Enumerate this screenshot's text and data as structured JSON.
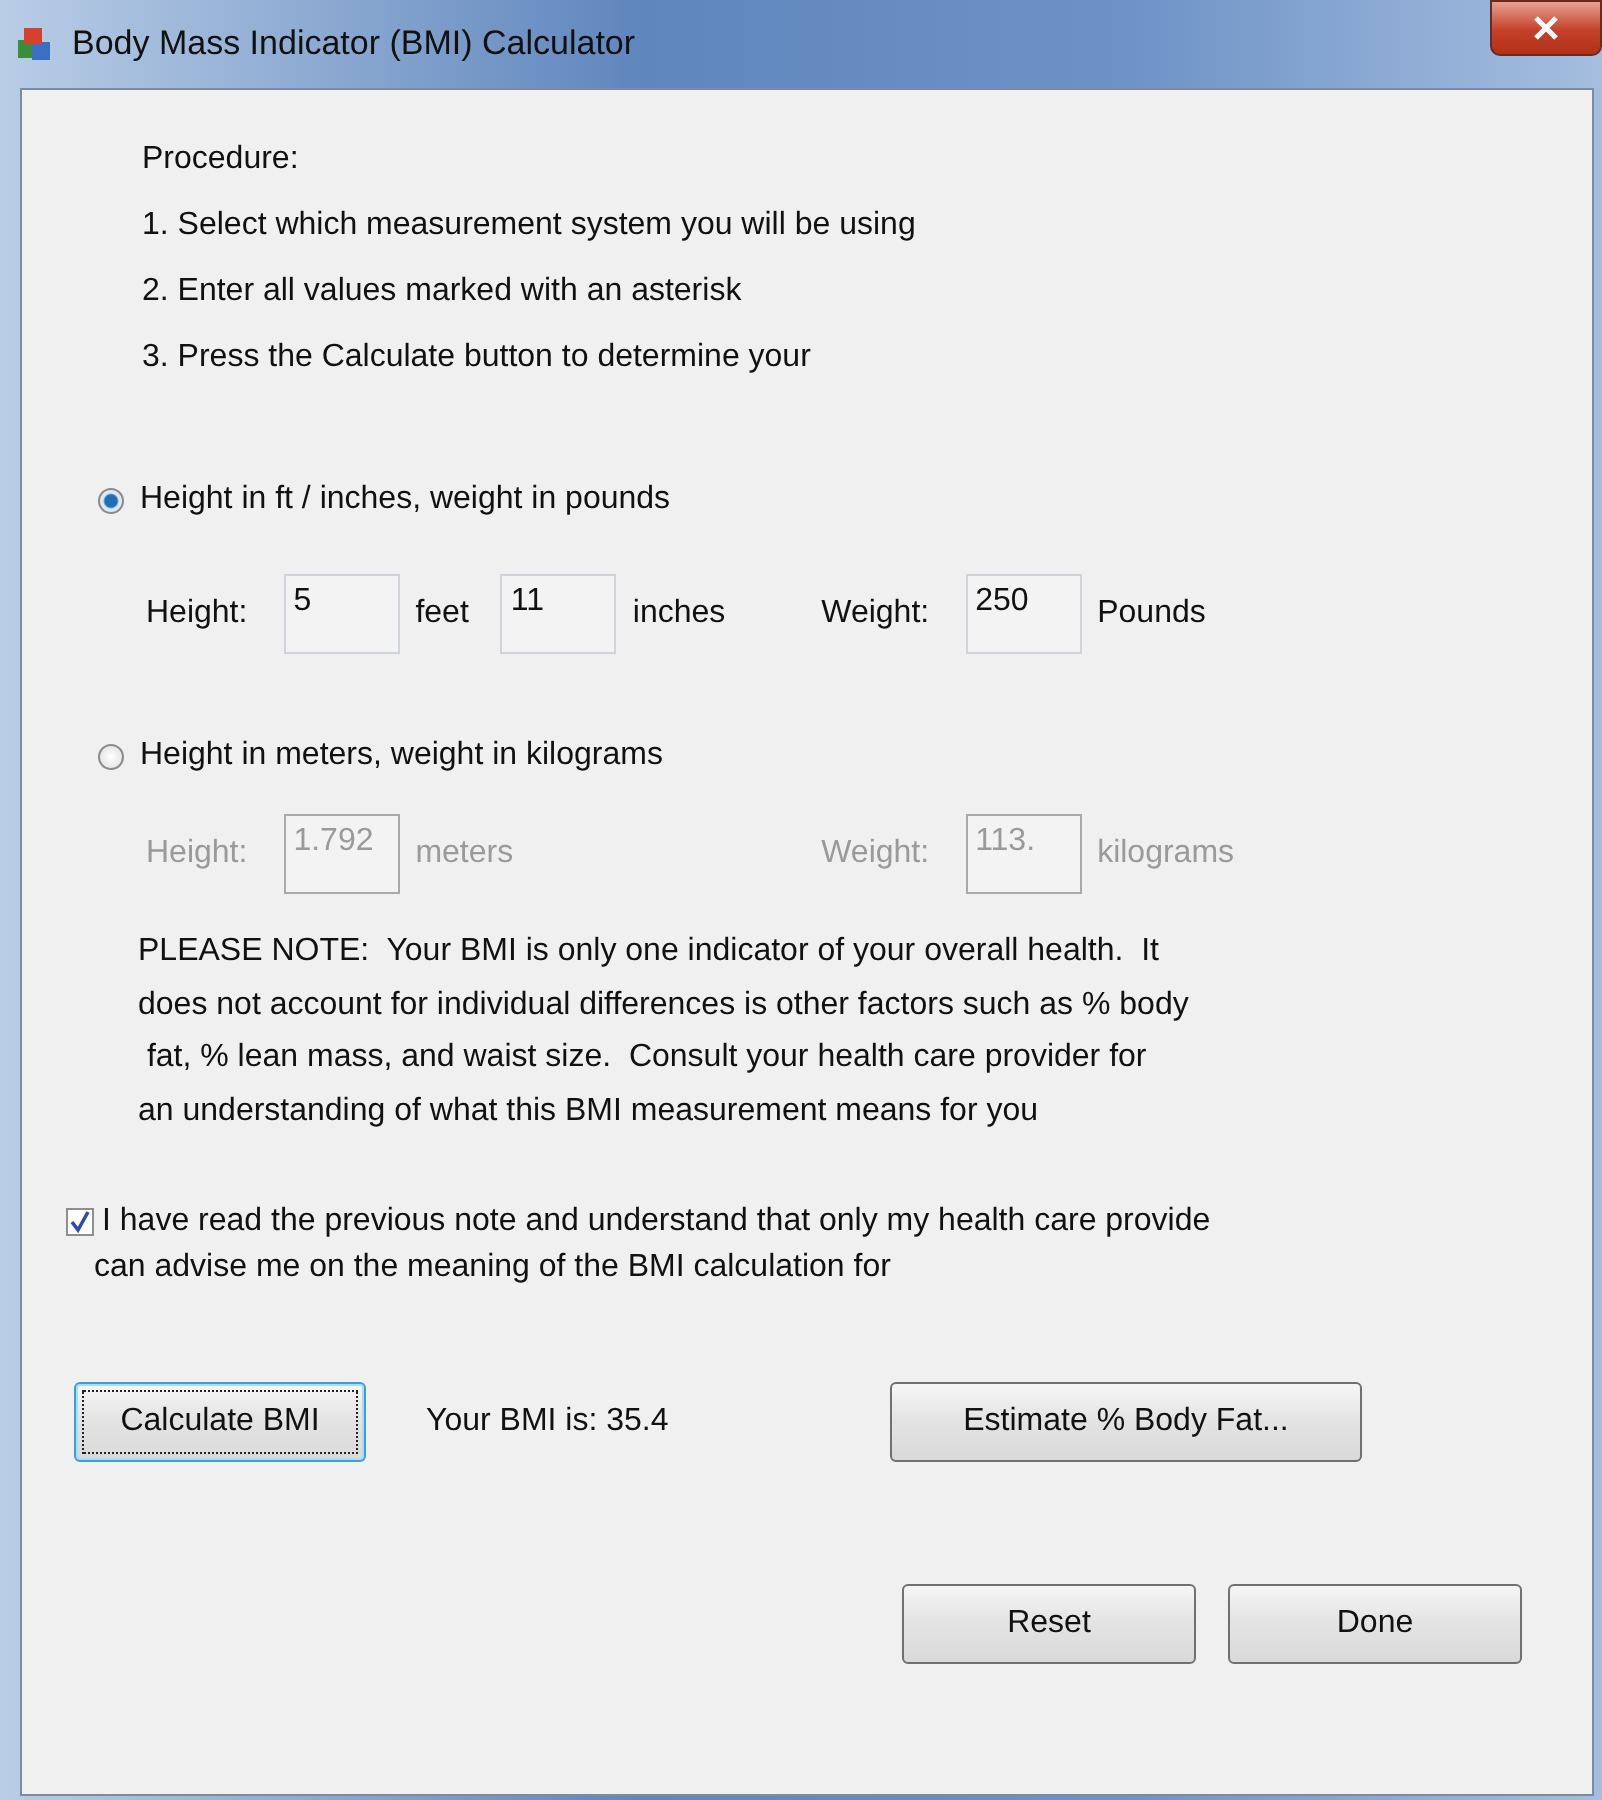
{
  "window": {
    "title": "Body Mass Indicator (BMI) Calculator"
  },
  "procedure": {
    "heading": "Procedure:",
    "steps": [
      "1. Select which measurement system you will be using",
      "2. Enter all values marked with an asterisk",
      "3. Press the Calculate button to determine your"
    ]
  },
  "options": [
    {
      "label": "Height in ft / inches, weight in pounds",
      "selected": true,
      "disabled": false,
      "groups": [
        {
          "label": "Height:",
          "entries": [
            {
              "value": "5",
              "unit": "feet"
            },
            {
              "value": "11",
              "unit": "inches"
            }
          ]
        },
        {
          "label": "Weight:",
          "entries": [
            {
              "value": "250",
              "unit": "Pounds"
            }
          ]
        }
      ]
    },
    {
      "label": "Height in meters, weight in kilograms",
      "selected": false,
      "disabled": true,
      "groups": [
        {
          "label": "Height:",
          "entries": [
            {
              "value": "1.792",
              "unit": "meters"
            }
          ]
        },
        {
          "label": "Weight:",
          "entries": [
            {
              "value": "113.",
              "unit": "kilograms"
            }
          ]
        }
      ]
    }
  ],
  "note": [
    "PLEASE NOTE:  Your BMI is only one indicator of your overall health.  It",
    "does not account for individual differences is other factors such as % body",
    " fat, % lean mass, and waist size.  Consult your health care provider for",
    "an understanding of what this BMI measurement means for you"
  ],
  "agreement": {
    "checked": true,
    "lines": [
      "I have read the previous note and understand that only my health care provide",
      "can advise me on the meaning of the BMI calculation for"
    ]
  },
  "calculate_button": {
    "label": "Calculate BMI",
    "focused": true
  },
  "result": "Your BMI is: 35.4",
  "body_fat_button": "Estimate % Body Fat...",
  "buttons": [
    "Reset",
    "Done"
  ]
}
